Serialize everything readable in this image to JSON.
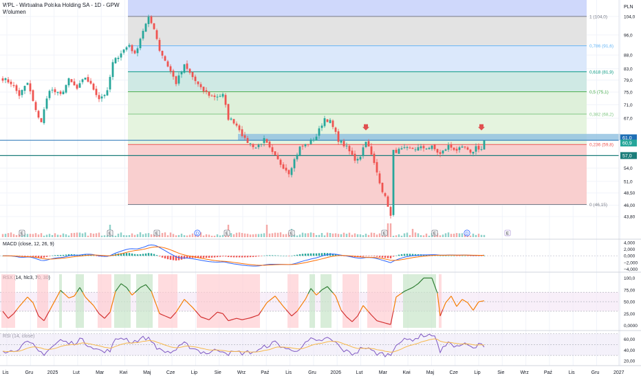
{
  "header": {
    "symbol": "WPL - Wirtualna Polska Holding SA - 1D - GPW",
    "volume_label": "Wolumen",
    "currency": "PLN"
  },
  "colors": {
    "up": "#26a69a",
    "down": "#ef5350",
    "fib_top": "#cfd8fb",
    "fib_1": "#e3e3e3",
    "fib_0786": "#dbe8fb",
    "fib_0618": "#cfe9e4",
    "fib_05": "#def0da",
    "fib_0382": "#e5f4df",
    "fib_0": "#f9cfcf",
    "zone_blue": "#8fbfe0",
    "line_teal": "#1b7d7a",
    "macd": "#2962ff",
    "signal": "#ff6d00",
    "rsx": "#f57c00",
    "rsi": "#7e57c2",
    "rsi_ma": "#f7b84a"
  },
  "chart_data": [
    {
      "type": "line",
      "name": "price",
      "y_scale": "log",
      "ylim": [
        41.9,
        110
      ],
      "y_ticks": [
        "104,0",
        "96,0",
        "88,0",
        "83,0",
        "79,0",
        "75,0",
        "71,0",
        "67,0",
        "54,0",
        "51,0",
        "48,50",
        "46,00",
        "43,80"
      ],
      "x_months": [
        "Lis",
        "Gru",
        "2025",
        "Lut",
        "Mar",
        "Kwi",
        "Maj",
        "Cze",
        "Lip",
        "Sie",
        "Wrz",
        "Paź",
        "Lis",
        "Gru",
        "2026",
        "Lut",
        "Mar",
        "Kwi",
        "Maj",
        "Cze",
        "Lip",
        "Sie",
        "Wrz",
        "Paź",
        "Lis",
        "Gru",
        "2027"
      ],
      "close_keypoints": [
        {
          "t": 0,
          "v": 79.5
        },
        {
          "t": 3,
          "v": 78
        },
        {
          "t": 6,
          "v": 74
        },
        {
          "t": 9,
          "v": 78
        },
        {
          "t": 12,
          "v": 69
        },
        {
          "t": 14,
          "v": 66
        },
        {
          "t": 17,
          "v": 76
        },
        {
          "t": 21,
          "v": 74
        },
        {
          "t": 24,
          "v": 79
        },
        {
          "t": 27,
          "v": 76
        },
        {
          "t": 30,
          "v": 80
        },
        {
          "t": 33,
          "v": 76
        },
        {
          "t": 35,
          "v": 73
        },
        {
          "t": 38,
          "v": 75
        },
        {
          "t": 40,
          "v": 85
        },
        {
          "t": 43,
          "v": 89
        },
        {
          "t": 46,
          "v": 92
        },
        {
          "t": 48,
          "v": 88
        },
        {
          "t": 51,
          "v": 98
        },
        {
          "t": 53,
          "v": 103
        },
        {
          "t": 55,
          "v": 99
        },
        {
          "t": 57,
          "v": 90
        },
        {
          "t": 60,
          "v": 84
        },
        {
          "t": 63,
          "v": 78
        },
        {
          "t": 66,
          "v": 84
        },
        {
          "t": 69,
          "v": 80
        },
        {
          "t": 72,
          "v": 76
        },
        {
          "t": 76,
          "v": 73.5
        },
        {
          "t": 80,
          "v": 74
        },
        {
          "t": 82,
          "v": 67
        },
        {
          "t": 84,
          "v": 66
        },
        {
          "t": 86,
          "v": 64
        },
        {
          "t": 88,
          "v": 61
        },
        {
          "t": 92,
          "v": 59
        },
        {
          "t": 95,
          "v": 61
        },
        {
          "t": 98,
          "v": 57.5
        },
        {
          "t": 101,
          "v": 55
        },
        {
          "t": 104,
          "v": 53
        },
        {
          "t": 106,
          "v": 56
        },
        {
          "t": 108,
          "v": 59
        },
        {
          "t": 111,
          "v": 60
        },
        {
          "t": 114,
          "v": 62
        },
        {
          "t": 117,
          "v": 67
        },
        {
          "t": 119,
          "v": 66
        },
        {
          "t": 122,
          "v": 61
        },
        {
          "t": 125,
          "v": 59
        },
        {
          "t": 128,
          "v": 56
        },
        {
          "t": 130,
          "v": 57
        },
        {
          "t": 132,
          "v": 61
        },
        {
          "t": 134,
          "v": 57
        },
        {
          "t": 136,
          "v": 53
        },
        {
          "t": 138,
          "v": 49
        },
        {
          "t": 140,
          "v": 46
        },
        {
          "t": 141,
          "v": 43.8
        },
        {
          "t": 142,
          "v": 58
        },
        {
          "t": 146,
          "v": 58.6
        },
        {
          "t": 150,
          "v": 58.8
        },
        {
          "t": 156,
          "v": 59.1
        },
        {
          "t": 159,
          "v": 57.3
        },
        {
          "t": 162,
          "v": 59.4
        },
        {
          "t": 165,
          "v": 58.4
        },
        {
          "t": 168,
          "v": 58.9
        },
        {
          "t": 170,
          "v": 57.3
        },
        {
          "t": 172,
          "v": 59.2
        },
        {
          "t": 174,
          "v": 58.6
        },
        {
          "t": 175,
          "v": 60.9
        }
      ],
      "fib_levels": [
        {
          "label": "1 (104,0)",
          "value": 104.0,
          "fill": "fib_1"
        },
        {
          "label": "0,786 (91,6)",
          "value": 91.6,
          "fill": "fib_0786"
        },
        {
          "label": "0,618 (81,9)",
          "value": 81.9,
          "fill": "fib_0618"
        },
        {
          "label": "0,5 (75,1)",
          "value": 75.1,
          "fill": "fib_05"
        },
        {
          "label": "0,382 (68,2)",
          "value": 68.2,
          "fill": "fib_0382"
        },
        {
          "label": "0,236 (59,8)",
          "value": 59.8,
          "fill": "fib_0"
        },
        {
          "label": "0 (46,15)",
          "value": 46.15,
          "fill": "fib_0"
        }
      ],
      "price_tags": [
        {
          "text": "61,0",
          "value": 61.0,
          "color": "#1e6fb5"
        },
        {
          "text": "60,9",
          "value": 60.9,
          "color": "#26a69a"
        },
        {
          "text": "57,0",
          "value": 57.0,
          "color": "#1b7d7a"
        }
      ],
      "zone": {
        "from": 60.9,
        "to": 62.6
      },
      "horizontal_line": 57.0,
      "event_markers": [
        "E",
        "E",
        "E",
        "D",
        "E",
        "E",
        "E",
        "E",
        "D",
        "E"
      ]
    },
    {
      "type": "line",
      "name": "MACD (close, 12, 26, 9)",
      "y_ticks": [
        "4,000",
        "2,000",
        "0,000",
        "−2,000",
        "−4,000"
      ],
      "ylim": [
        -4.5,
        4.6
      ]
    },
    {
      "type": "line",
      "name": "RSX (14, hlc3, 70, 30)",
      "y_ticks": [
        "100,0",
        "75,00",
        "50,00",
        "25,00",
        "0,0000"
      ],
      "ylim": [
        -5,
        108
      ],
      "keypoints": [
        {
          "t": 0,
          "v": 30
        },
        {
          "t": 2,
          "v": 15
        },
        {
          "t": 4,
          "v": 25
        },
        {
          "t": 6,
          "v": 40
        },
        {
          "t": 9,
          "v": 60
        },
        {
          "t": 11,
          "v": 48
        },
        {
          "t": 13,
          "v": 20
        },
        {
          "t": 15,
          "v": 10
        },
        {
          "t": 18,
          "v": 42
        },
        {
          "t": 21,
          "v": 74
        },
        {
          "t": 24,
          "v": 58
        },
        {
          "t": 26,
          "v": 62
        },
        {
          "t": 28,
          "v": 80
        },
        {
          "t": 30,
          "v": 60
        },
        {
          "t": 33,
          "v": 42
        },
        {
          "t": 35,
          "v": 25
        },
        {
          "t": 37,
          "v": 15
        },
        {
          "t": 39,
          "v": 28
        },
        {
          "t": 41,
          "v": 72
        },
        {
          "t": 43,
          "v": 88
        },
        {
          "t": 45,
          "v": 80
        },
        {
          "t": 47,
          "v": 64
        },
        {
          "t": 50,
          "v": 80
        },
        {
          "t": 52,
          "v": 86
        },
        {
          "t": 54,
          "v": 72
        },
        {
          "t": 57,
          "v": 25
        },
        {
          "t": 61,
          "v": 15
        },
        {
          "t": 63,
          "v": 28
        },
        {
          "t": 66,
          "v": 55
        },
        {
          "t": 69,
          "v": 38
        },
        {
          "t": 72,
          "v": 18
        },
        {
          "t": 75,
          "v": 12
        },
        {
          "t": 78,
          "v": 28
        },
        {
          "t": 80,
          "v": 25
        },
        {
          "t": 82,
          "v": 10
        },
        {
          "t": 85,
          "v": 15
        },
        {
          "t": 87,
          "v": 12
        },
        {
          "t": 90,
          "v": 16
        },
        {
          "t": 93,
          "v": 22
        },
        {
          "t": 96,
          "v": 48
        },
        {
          "t": 99,
          "v": 62
        },
        {
          "t": 102,
          "v": 40
        },
        {
          "t": 105,
          "v": 20
        },
        {
          "t": 107,
          "v": 30
        },
        {
          "t": 110,
          "v": 55
        },
        {
          "t": 112,
          "v": 78
        },
        {
          "t": 114,
          "v": 64
        },
        {
          "t": 116,
          "v": 75
        },
        {
          "t": 118,
          "v": 82
        },
        {
          "t": 121,
          "v": 62
        },
        {
          "t": 123,
          "v": 32
        },
        {
          "t": 125,
          "v": 18
        },
        {
          "t": 127,
          "v": 8
        },
        {
          "t": 129,
          "v": 20
        },
        {
          "t": 131,
          "v": 42
        },
        {
          "t": 134,
          "v": 22
        },
        {
          "t": 136,
          "v": 10
        },
        {
          "t": 139,
          "v": 5
        },
        {
          "t": 141,
          "v": 2
        },
        {
          "t": 143,
          "v": 60
        },
        {
          "t": 146,
          "v": 72
        },
        {
          "t": 149,
          "v": 80
        },
        {
          "t": 151,
          "v": 88
        },
        {
          "t": 153,
          "v": 100
        },
        {
          "t": 156,
          "v": 100
        },
        {
          "t": 158,
          "v": 68
        },
        {
          "t": 159,
          "v": 20
        },
        {
          "t": 161,
          "v": 48
        },
        {
          "t": 163,
          "v": 62
        },
        {
          "t": 165,
          "v": 40
        },
        {
          "t": 167,
          "v": 55
        },
        {
          "t": 169,
          "v": 48
        },
        {
          "t": 171,
          "v": 32
        },
        {
          "t": 173,
          "v": 50
        },
        {
          "t": 175,
          "v": 52
        }
      ]
    },
    {
      "type": "line",
      "name": "RSI (14, close)",
      "y_ticks": [
        "60,00",
        "40,00",
        "20,00"
      ],
      "ylim": [
        15,
        72
      ]
    }
  ]
}
